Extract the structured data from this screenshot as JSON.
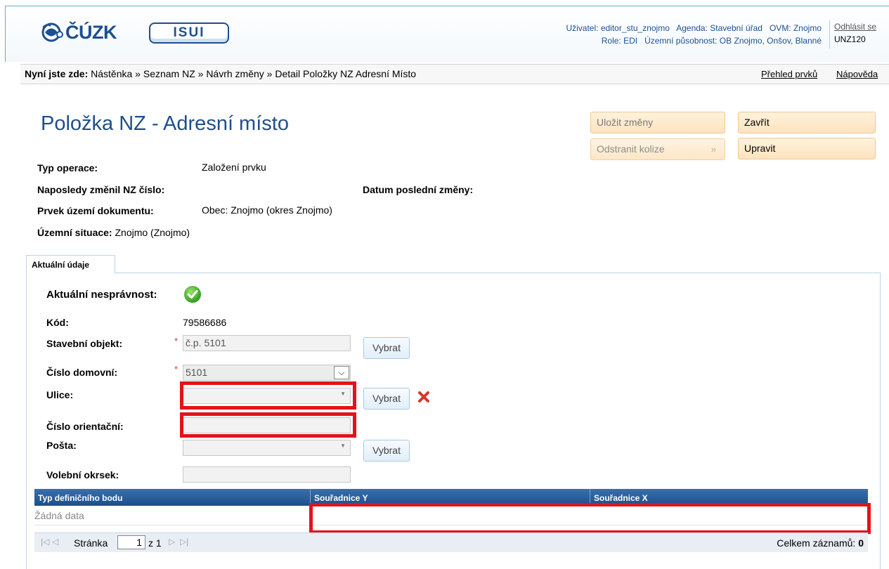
{
  "header": {
    "logo_text": "ČÚZK",
    "app_logo": "ISUI",
    "user_line1": "Uživatel: editor_stu_znojmo   Agenda: Stavební úřad   OVM: Znojmo",
    "user_line2": "Role: EDI   Územní působnost: OB Znojmo, Onšov, Blanné",
    "logout": "Odhlásit se",
    "user_code": "UNZ120"
  },
  "breadcrumb": {
    "prefix": "Nyní jste zde:",
    "path": "Nástěnka » Seznam NZ » Návrh změny » Detail Položky NZ Adresní Místo",
    "link_overview": "Přehled prvků",
    "link_help": "Nápověda"
  },
  "page": {
    "title": "Položka NZ - Adresní místo"
  },
  "actions": {
    "save": "Uložit změny",
    "remove_conflicts": "Odstranit kolize",
    "close": "Zavřít",
    "edit": "Upravit"
  },
  "info": {
    "op_type_label": "Typ operace:",
    "op_type_value": "Založení prvku",
    "last_changed_label": "Naposledy změnil NZ číslo:",
    "last_change_date_label": "Datum poslední změny:",
    "element_label": "Prvek území dokumentu:",
    "element_value": "Obec: Znojmo (okres Znojmo)",
    "situation_label": "Územní situace:",
    "situation_value": "Znojmo (Znojmo)"
  },
  "tab": {
    "label": "Aktuální údaje"
  },
  "form": {
    "incorrectness_label": "Aktuální nesprávnost:",
    "code_label": "Kód:",
    "code_value": "79586686",
    "building_label": "Stavební objekt:",
    "building_value": "č.p. 5101",
    "house_no_label": "Číslo domovní:",
    "house_no_value": "5101",
    "street_label": "Ulice:",
    "street_value": "",
    "orient_label": "Číslo orientační:",
    "orient_value": "",
    "post_label": "Pošta:",
    "post_value": "",
    "district_label": "Volební okrsek:",
    "district_value": "",
    "select_button": "Vybrat",
    "required_mark": "*"
  },
  "grid": {
    "columns": [
      "Typ definičního bodu",
      "Souřadnice Y",
      "Souřadnice X"
    ],
    "empty_text": "Žádná data",
    "page_label": "Stránka",
    "page_value": "1",
    "page_of": "z 1",
    "total_label": "Celkem záznamů:",
    "total_value": "0"
  }
}
